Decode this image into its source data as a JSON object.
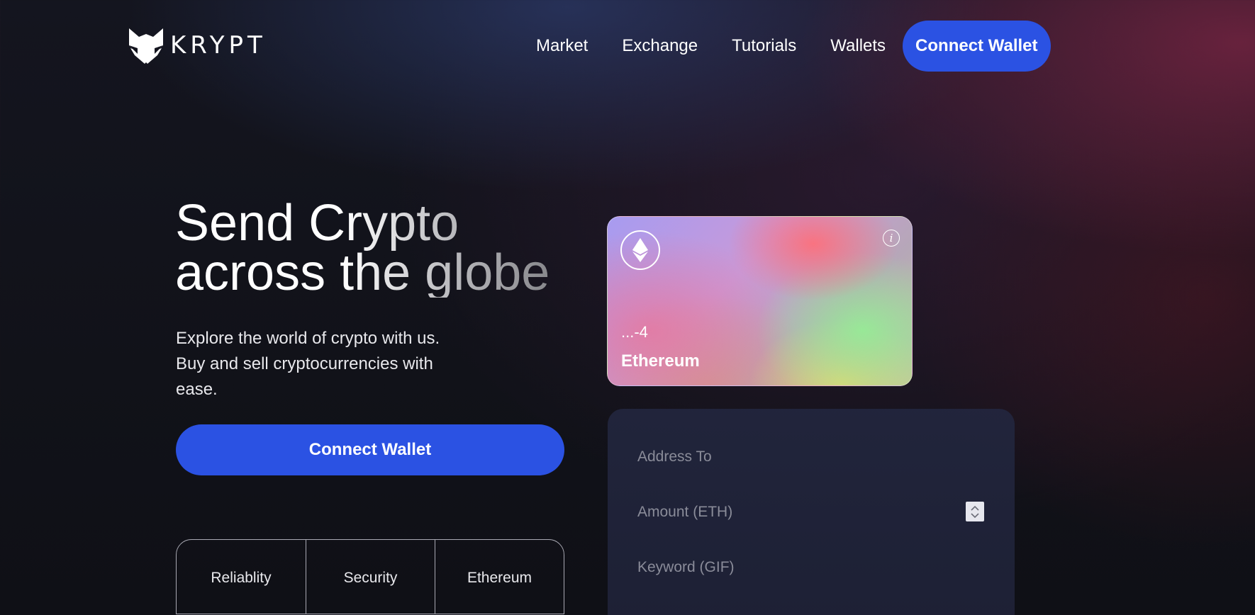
{
  "brand": {
    "name": "KRYPT",
    "logo_icon": "fox-head-icon"
  },
  "nav": {
    "items": [
      "Market",
      "Exchange",
      "Tutorials",
      "Wallets"
    ],
    "connect_label": "Connect Wallet"
  },
  "hero": {
    "title_line1": "Send Crypto",
    "title_line2": "across the globe",
    "desc_line1": "Explore the world of crypto with us.",
    "desc_line2": "Buy and sell cryptocurrencies with",
    "desc_line3": "ease.",
    "connect_label": "Connect Wallet"
  },
  "features": [
    "Reliablity",
    "Security",
    "Ethereum"
  ],
  "card": {
    "address": "...-4",
    "network": "Ethereum",
    "logo_icon": "ethereum-icon",
    "info_icon": "info-icon",
    "info_glyph": "i"
  },
  "form": {
    "address_placeholder": "Address To",
    "amount_placeholder": "Amount (ETH)",
    "keyword_placeholder": "Keyword (GIF)"
  },
  "colors": {
    "accent": "#2b52e3",
    "background": "#111219",
    "panel": "#22263e"
  }
}
